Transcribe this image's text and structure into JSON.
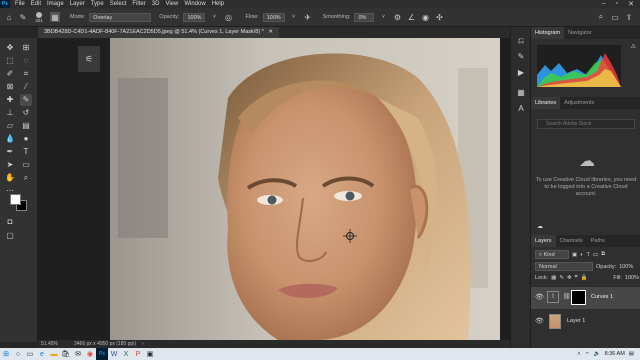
{
  "menubar": {
    "app_icon": "photoshop-logo",
    "items": [
      "File",
      "Edit",
      "Image",
      "Layer",
      "Type",
      "Select",
      "Filter",
      "3D",
      "View",
      "Window",
      "Help"
    ]
  },
  "options": {
    "brush_size": "321",
    "mode_label": "Mode:",
    "mode_value": "Overlay",
    "opacity_label": "Opacity:",
    "opacity_value": "100%",
    "flow_label": "Flow:",
    "flow_value": "100%",
    "smoothing_label": "Smoothing:",
    "smoothing_value": "0%"
  },
  "document": {
    "tab_title": "3BDB428D-C4D1-4ADF-840F-7A21EAC2D5D5.jpeg @ 51.4% (Curves 1, Layer Mask/8) *",
    "zoom": "51.45%",
    "dimensions": "3466 px x 4950 px (180 ppi)"
  },
  "histogram": {
    "tabs": [
      "Histogram",
      "Navigator"
    ]
  },
  "libraries": {
    "tabs": [
      "Libraries",
      "Adjustments"
    ],
    "search_placeholder": "Search Adobe Stock",
    "message": "To use Creative Cloud libraries, you need to be logged into a Creative Cloud account."
  },
  "layers": {
    "tabs": [
      "Layers",
      "Channels",
      "Paths"
    ],
    "kind_value": "Kind",
    "blend_mode": "Normal",
    "opacity_label": "Opacity:",
    "opacity_value": "100%",
    "lock_label": "Lock:",
    "fill_label": "Fill:",
    "fill_value": "100%",
    "items": [
      {
        "name": "Curves 1"
      },
      {
        "name": "Layer 1"
      }
    ]
  },
  "taskbar": {
    "time": "8:36 AM",
    "icons": [
      "windows-start-icon",
      "search-icon",
      "task-view-icon",
      "edge-icon",
      "folder-icon",
      "store-icon",
      "mail-icon",
      "chrome-icon",
      "photoshop-icon",
      "word-icon",
      "excel-icon",
      "powerpoint-icon",
      "photos-icon"
    ]
  },
  "colors": {
    "accent": "#31a8ff",
    "panel_bg": "#2f2f2f",
    "canvas_bg": "#1f1f1f"
  }
}
